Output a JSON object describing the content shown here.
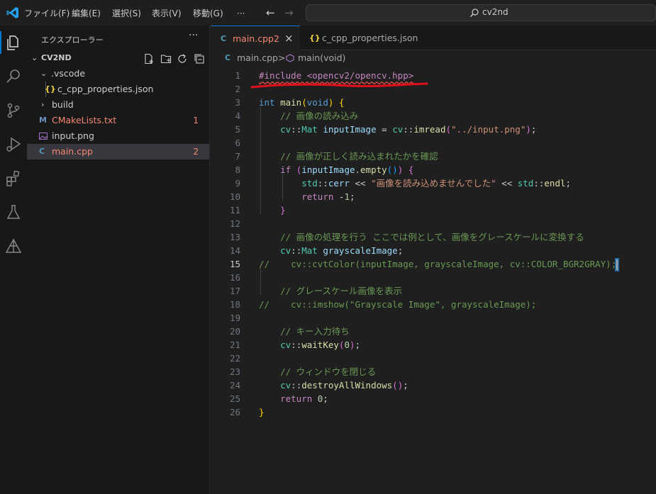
{
  "titlebar": {
    "menus": [
      "ファイル(F)",
      "編集(E)",
      "選択(S)",
      "表示(V)",
      "移動(G)",
      "···"
    ],
    "search_text": "cv2nd"
  },
  "sidebar": {
    "title": "エクスプローラー",
    "more": "···",
    "root": "CV2ND",
    "items": [
      {
        "label": ".vscode",
        "type": "folder-open"
      },
      {
        "label": "c_cpp_properties.json",
        "type": "json",
        "icon": "{}"
      },
      {
        "label": "build",
        "type": "folder-closed"
      },
      {
        "label": "CMakeLists.txt",
        "type": "cmake",
        "icon": "M",
        "badge": "1"
      },
      {
        "label": "input.png",
        "type": "image"
      },
      {
        "label": "main.cpp",
        "type": "cpp",
        "icon": "C",
        "badge": "2"
      }
    ]
  },
  "tabs": [
    {
      "label": "main.cpp",
      "badge": "2",
      "close": "×",
      "icon": "C"
    },
    {
      "label": "c_cpp_properties.json",
      "icon": "{}"
    }
  ],
  "breadcrumb": {
    "file": "main.cpp",
    "sep": ">",
    "symbol": "main(void)"
  },
  "colors": {
    "accent": "#0078d4",
    "error": "#f14c4c",
    "annotation": "#e0101a"
  },
  "code": {
    "current_line": 15,
    "lines": [
      "#include <opencv2/opencv.hpp>",
      "",
      "int main(void) {",
      "    // 画像の読み込み",
      "    cv::Mat inputImage = cv::imread(\"../input.png\");",
      "",
      "    // 画像が正しく読み込まれたかを確認",
      "    if (inputImage.empty()) {",
      "        std::cerr << \"画像を読み込めませんでした\" << std::endl;",
      "        return -1;",
      "    }",
      "",
      "    // 画像の処理を行う ここでは例として、画像をグレースケールに変換する",
      "    cv::Mat grayscaleImage;",
      "//    cv::cvtColor(inputImage, grayscaleImage, cv::COLOR_BGR2GRAY);",
      "",
      "    // グレースケール画像を表示",
      "//    cv::imshow(\"Grayscale Image\", grayscaleImage);",
      "",
      "    // キー入力待ち",
      "    cv::waitKey(0);",
      "",
      "    // ウィンドウを閉じる",
      "    cv::destroyAllWindows();",
      "    return 0;",
      "}"
    ]
  }
}
